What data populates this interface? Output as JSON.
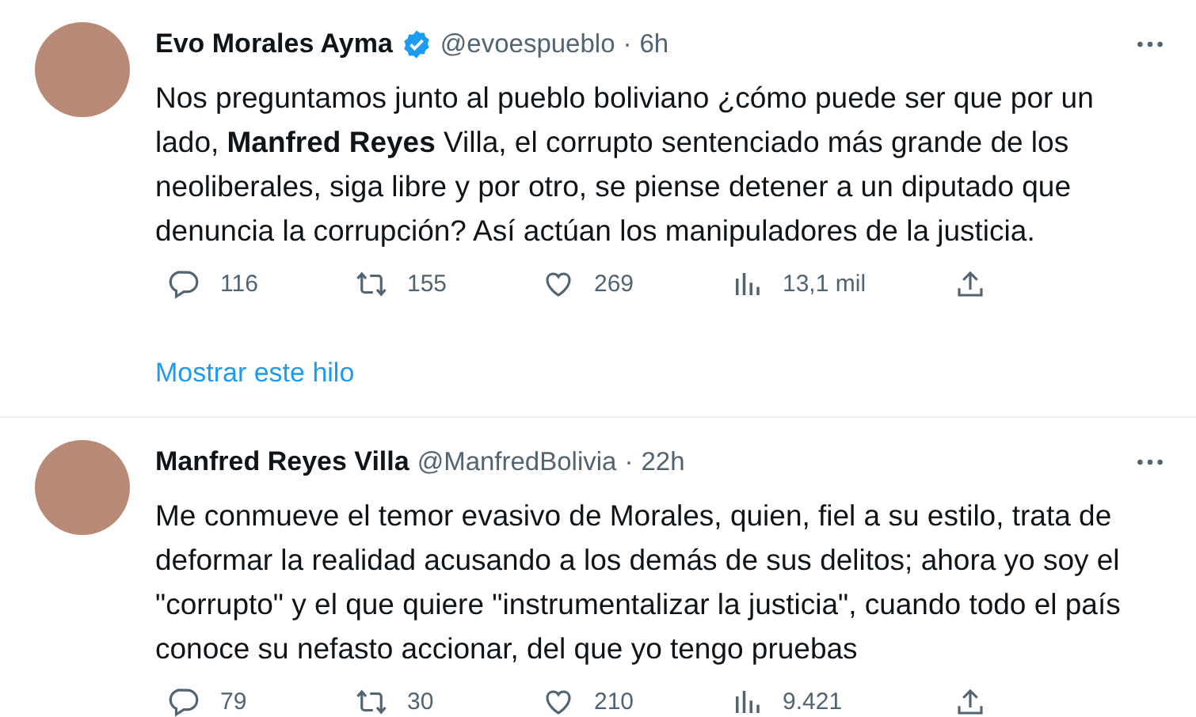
{
  "tweets": [
    {
      "name": "Evo Morales Ayma",
      "verified": true,
      "handle": "@evoespueblo",
      "separator": "·",
      "time": "6h",
      "text": "Nos preguntamos junto al pueblo boliviano ¿cómo puede ser que por un lado, **Manfred Reyes** Villa, el corrupto sentenciado más grande de los neoliberales, siga libre y por otro, se piense detener a un diputado que denuncia la corrupción? Así actúan los manipuladores de la justicia.",
      "replies": "116",
      "retweets": "155",
      "likes": "269",
      "views": "13,1 mil",
      "thread_link": "Mostrar este hilo"
    },
    {
      "name": "Manfred Reyes Villa",
      "verified": false,
      "handle": "@ManfredBolivia",
      "separator": "·",
      "time": "22h",
      "text": "Me conmueve el temor evasivo de Morales, quien, fiel a su estilo, trata de deformar la realidad acusando a los demás de sus delitos; ahora yo soy el \"corrupto\" y el que quiere \"instrumentalizar la justicia\", cuando todo el país conoce su nefasto accionar, del que yo tengo pruebas",
      "replies": "79",
      "retweets": "30",
      "likes": "210",
      "views": "9.421"
    }
  ]
}
